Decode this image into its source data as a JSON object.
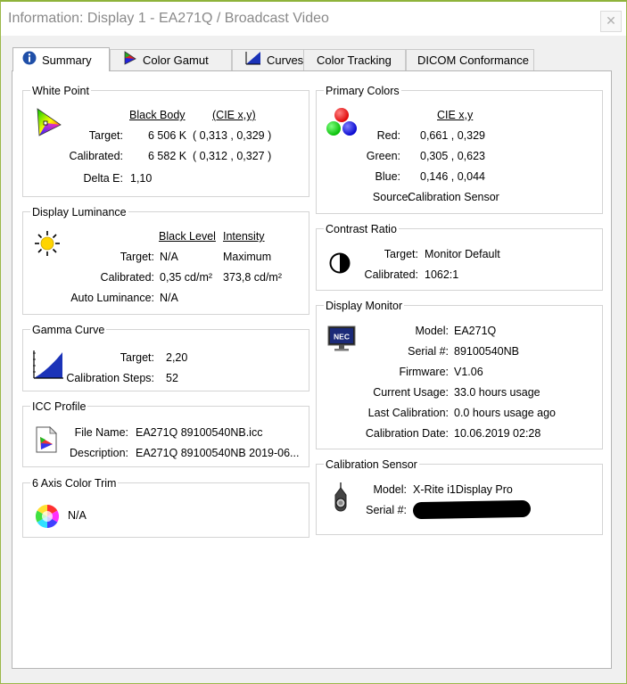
{
  "window": {
    "title": "Information: Display 1 - EA271Q / Broadcast Video",
    "close_glyph": "✕"
  },
  "tabs": [
    {
      "label": "Summary"
    },
    {
      "label": "Color Gamut"
    },
    {
      "label": "Curves"
    },
    {
      "label": "Color Tracking"
    },
    {
      "label": "DICOM Conformance"
    }
  ],
  "white_point": {
    "title": "White Point",
    "col_black_body": "Black Body",
    "col_cie": "(CIE x,y)",
    "target_label": "Target:",
    "target_bb": "6 506 K",
    "target_cie": "( 0,313 , 0,329 )",
    "calibrated_label": "Calibrated:",
    "calibrated_bb": "6 582 K",
    "calibrated_cie": "( 0,312 , 0,327 )",
    "delta_label": "Delta E:",
    "delta_value": "1,10"
  },
  "luminance": {
    "title": "Display Luminance",
    "col_black": "Black Level",
    "col_intensity": "Intensity",
    "target_label": "Target:",
    "target_black": "N/A",
    "target_intensity": "Maximum",
    "calibrated_label": "Calibrated:",
    "calibrated_black": "0,35 cd/m²",
    "calibrated_intensity": "373,8 cd/m²",
    "auto_label": "Auto Luminance:",
    "auto_value": "N/A"
  },
  "gamma": {
    "title": "Gamma Curve",
    "target_label": "Target:",
    "target_value": "2,20",
    "steps_label": "Calibration Steps:",
    "steps_value": "52"
  },
  "icc": {
    "title": "ICC Profile",
    "file_label": "File Name:",
    "file_value": "EA271Q 89100540NB.icc",
    "desc_label": "Description:",
    "desc_value": "EA271Q 89100540NB 2019-06..."
  },
  "trim": {
    "title": "6 Axis Color Trim",
    "value": "N/A"
  },
  "primary": {
    "title": "Primary Colors",
    "col_cie": "CIE x,y",
    "red_label": "Red:",
    "red_value": "0,661 , 0,329",
    "green_label": "Green:",
    "green_value": "0,305 , 0,623",
    "blue_label": "Blue:",
    "blue_value": "0,146 , 0,044",
    "source_label": "Source:",
    "source_value": "Calibration Sensor"
  },
  "contrast": {
    "title": "Contrast Ratio",
    "target_label": "Target:",
    "target_value": "Monitor Default",
    "calibrated_label": "Calibrated:",
    "calibrated_value": "1062:1"
  },
  "monitor": {
    "title": "Display Monitor",
    "logo_text": "NEC",
    "model_label": "Model:",
    "model_value": "EA271Q",
    "serial_label": "Serial #:",
    "serial_value": "89100540NB",
    "firmware_label": "Firmware:",
    "firmware_value": "V1.06",
    "usage_label": "Current Usage:",
    "usage_value": "33.0 hours usage",
    "lastcal_label": "Last Calibration:",
    "lastcal_value": "0.0 hours usage ago",
    "caldate_label": "Calibration Date:",
    "caldate_value": "10.06.2019 02:28"
  },
  "sensor": {
    "title": "Calibration Sensor",
    "model_label": "Model:",
    "model_value": "X-Rite i1Display Pro",
    "serial_label": "Serial #:"
  },
  "icons": [
    "info-icon",
    "color-gamut-icon",
    "curves-icon",
    "cie-chromaticity-icon",
    "sun-icon",
    "gamma-curve-icon",
    "icc-document-icon",
    "color-wheel-icon",
    "rgb-circles-icon",
    "contrast-icon",
    "nec-monitor-icon",
    "colorimeter-icon"
  ]
}
